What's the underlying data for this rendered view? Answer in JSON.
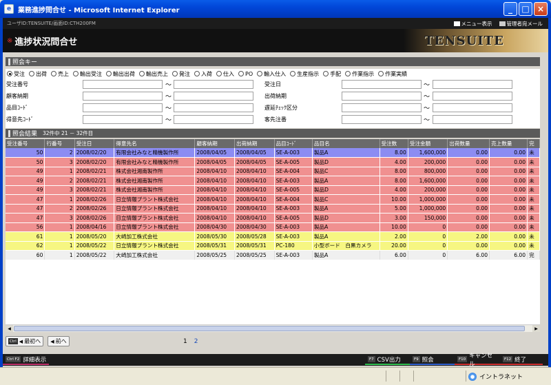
{
  "window": {
    "title": "業務進捗問合せ - Microsoft Internet Explorer",
    "buttons": [
      "_",
      "□",
      "×"
    ]
  },
  "header": {
    "user_info": "ユーザID:TENSUITE/画面ID:CTH200FM",
    "menu_link": "メニュー表示",
    "admin_link": "管理者宛メール",
    "title_mark": "※",
    "title": "進捗状況問合せ",
    "logo": "TENSUITE"
  },
  "query_section": {
    "title": "照会キー",
    "radio_options": [
      "受注",
      "出荷",
      "売上",
      "輸出受注",
      "輸出出荷",
      "輸出売上",
      "発注",
      "入荷",
      "仕入",
      "PO",
      "輸入仕入",
      "生産指示",
      "手配",
      "作業指示",
      "作業実績"
    ],
    "selected": "受注",
    "fields": [
      {
        "label": "受注番号"
      },
      {
        "label": "顧客納期"
      },
      {
        "label": "品目ｺｰﾄﾞ"
      },
      {
        "label": "得意先ｺｰﾄﾞ"
      },
      {
        "label": "受注日"
      },
      {
        "label": "出荷納期"
      },
      {
        "label": "遅延ﾁｪｯｸ区分"
      },
      {
        "label": "客先注番"
      }
    ],
    "range_sep": "～"
  },
  "results": {
    "title": "照会結果",
    "count_text": "32件中 21 － 32件目",
    "columns": [
      "受注番号",
      "行番号",
      "受注日",
      "得意先名",
      "顧客納期",
      "出荷納期",
      "品目ｺｰﾄﾞ",
      "品目名",
      "受注数",
      "受注金額",
      "出荷数量",
      "売上数量",
      "完"
    ],
    "rows": [
      {
        "c": [
          "50",
          "2",
          "2008/02/20",
          "有限会社みなと精機製作所",
          "2008/04/05",
          "2008/04/05",
          "SE-A-003",
          "製品A",
          "8.00",
          "1,600,000",
          "0.00",
          "0.00",
          "未"
        ],
        "style": "sel"
      },
      {
        "c": [
          "50",
          "3",
          "2008/02/20",
          "有限会社みなと精機製作所",
          "2008/04/05",
          "2008/04/05",
          "SE-A-005",
          "製品D",
          "4.00",
          "200,000",
          "0.00",
          "0.00",
          "未"
        ],
        "style": "red"
      },
      {
        "c": [
          "49",
          "1",
          "2008/02/21",
          "株式会社湘南製作所",
          "2008/04/10",
          "2008/04/10",
          "SE-A-004",
          "製品C",
          "8.00",
          "800,000",
          "0.00",
          "0.00",
          "未"
        ],
        "style": "red"
      },
      {
        "c": [
          "49",
          "2",
          "2008/02/21",
          "株式会社湘南製作所",
          "2008/04/10",
          "2008/04/10",
          "SE-A-003",
          "製品A",
          "8.00",
          "1,600,000",
          "0.00",
          "0.00",
          "未"
        ],
        "style": "red"
      },
      {
        "c": [
          "49",
          "3",
          "2008/02/21",
          "株式会社湘南製作所",
          "2008/04/10",
          "2008/04/10",
          "SE-A-005",
          "製品D",
          "4.00",
          "200,000",
          "0.00",
          "0.00",
          "未"
        ],
        "style": "red"
      },
      {
        "c": [
          "47",
          "1",
          "2008/02/26",
          "日立情報プラント株式会社",
          "2008/04/10",
          "2008/04/10",
          "SE-A-004",
          "製品C",
          "10.00",
          "1,000,000",
          "0.00",
          "0.00",
          "未"
        ],
        "style": "red"
      },
      {
        "c": [
          "47",
          "2",
          "2008/02/26",
          "日立情報プラント株式会社",
          "2008/04/10",
          "2008/04/10",
          "SE-A-003",
          "製品A",
          "5.00",
          "1,000,000",
          "0.00",
          "0.00",
          "未"
        ],
        "style": "red"
      },
      {
        "c": [
          "47",
          "3",
          "2008/02/26",
          "日立情報プラント株式会社",
          "2008/04/10",
          "2008/04/10",
          "SE-A-005",
          "製品D",
          "3.00",
          "150,000",
          "0.00",
          "0.00",
          "未"
        ],
        "style": "red"
      },
      {
        "c": [
          "56",
          "1",
          "2008/04/16",
          "日立情報プラント株式会社",
          "2008/04/30",
          "2008/04/30",
          "SE-A-003",
          "製品A",
          "10.00",
          "0",
          "0.00",
          "0.00",
          "未"
        ],
        "style": "red"
      },
      {
        "c": [
          "61",
          "1",
          "2008/05/20",
          "大崎加工株式会社",
          "2008/05/30",
          "2008/05/28",
          "SE-A-003",
          "製品A",
          "2.00",
          "0",
          "2.00",
          "0.00",
          "未"
        ],
        "style": "yel"
      },
      {
        "c": [
          "62",
          "1",
          "2008/05/22",
          "日立情報プラント株式会社",
          "2008/05/31",
          "2008/05/31",
          "PC-180",
          "小型ボード　白黒カメラ",
          "20.00",
          "0",
          "0.00",
          "0.00",
          "未"
        ],
        "style": "yel"
      },
      {
        "c": [
          "60",
          "1",
          "2008/05/22",
          "大崎加工株式会社",
          "2008/05/25",
          "2008/05/25",
          "SE-A-003",
          "製品A",
          "6.00",
          "0",
          "6.00",
          "6.00",
          "完"
        ],
        "style": "wht"
      }
    ]
  },
  "pager": {
    "first_key": "Ctrl",
    "first_label": "最初へ",
    "prev_label": "前へ",
    "pages": [
      "1",
      "2"
    ]
  },
  "function_keys": {
    "detail_key": "Ctrl F2",
    "detail_label": "詳細表示",
    "csv_key": "F7",
    "csv_label": "CSV出力",
    "inquiry_key": "F9",
    "inquiry_label": "照会",
    "cancel_key": "F10",
    "cancel_label": "キャンセル",
    "exit_key": "F12",
    "exit_label": "終了"
  },
  "status_bar": {
    "zone": "イントラネット"
  },
  "colors": {
    "selected_row": "#8c8cf2",
    "delayed_row": "#f09090",
    "warning_row": "#f6f682",
    "header_gray": "#6a6a6a"
  }
}
